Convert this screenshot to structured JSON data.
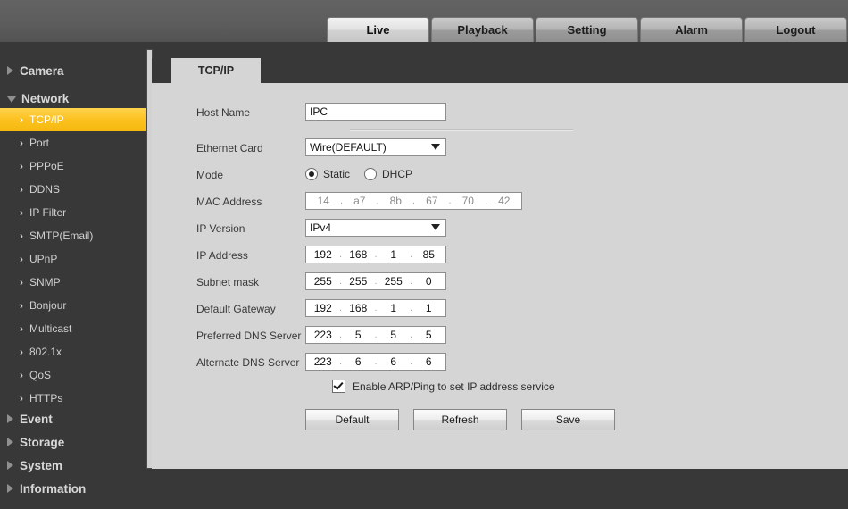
{
  "header": {
    "tabs": [
      {
        "label": "Live",
        "active": true
      },
      {
        "label": "Playback",
        "active": false
      },
      {
        "label": "Setting",
        "active": false
      },
      {
        "label": "Alarm",
        "active": false
      },
      {
        "label": "Logout",
        "active": false
      }
    ]
  },
  "sidebar": {
    "groups": [
      {
        "label": "Camera",
        "expanded": false
      },
      {
        "label": "Network",
        "expanded": true
      },
      {
        "label": "Event",
        "expanded": false
      },
      {
        "label": "Storage",
        "expanded": false
      },
      {
        "label": "System",
        "expanded": false
      },
      {
        "label": "Information",
        "expanded": false
      }
    ],
    "network_items": [
      {
        "label": "TCP/IP",
        "selected": true
      },
      {
        "label": "Port",
        "selected": false
      },
      {
        "label": "PPPoE",
        "selected": false
      },
      {
        "label": "DDNS",
        "selected": false
      },
      {
        "label": "IP Filter",
        "selected": false
      },
      {
        "label": "SMTP(Email)",
        "selected": false
      },
      {
        "label": "UPnP",
        "selected": false
      },
      {
        "label": "SNMP",
        "selected": false
      },
      {
        "label": "Bonjour",
        "selected": false
      },
      {
        "label": "Multicast",
        "selected": false
      },
      {
        "label": "802.1x",
        "selected": false
      },
      {
        "label": "QoS",
        "selected": false
      },
      {
        "label": "HTTPs",
        "selected": false
      }
    ]
  },
  "panel": {
    "tab_label": "TCP/IP"
  },
  "form": {
    "host_name": {
      "label": "Host Name",
      "value": "IPC"
    },
    "ethernet_card": {
      "label": "Ethernet Card",
      "value": "Wire(DEFAULT)"
    },
    "mode": {
      "label": "Mode",
      "selected": "Static",
      "options": [
        {
          "label": "Static",
          "checked": true
        },
        {
          "label": "DHCP",
          "checked": false
        }
      ]
    },
    "mac_address": {
      "label": "MAC Address",
      "readonly": true,
      "octets": [
        "14",
        "a7",
        "8b",
        "67",
        "70",
        "42"
      ]
    },
    "ip_version": {
      "label": "IP Version",
      "value": "IPv4"
    },
    "ip_address": {
      "label": "IP Address",
      "octets": [
        "192",
        "168",
        "1",
        "85"
      ]
    },
    "subnet_mask": {
      "label": "Subnet mask",
      "octets": [
        "255",
        "255",
        "255",
        "0"
      ]
    },
    "default_gateway": {
      "label": "Default Gateway",
      "octets": [
        "192",
        "168",
        "1",
        "1"
      ]
    },
    "preferred_dns": {
      "label": "Preferred DNS Server",
      "octets": [
        "223",
        "5",
        "5",
        "5"
      ]
    },
    "alternate_dns": {
      "label": "Alternate DNS Server",
      "octets": [
        "223",
        "6",
        "6",
        "6"
      ]
    },
    "arp_ping": {
      "label": "Enable ARP/Ping to set IP address service",
      "checked": true
    }
  },
  "buttons": [
    {
      "label": "Default"
    },
    {
      "label": "Refresh"
    },
    {
      "label": "Save"
    }
  ],
  "colors": {
    "accent": "#fcc11f",
    "panel_bg": "#d5d5d5",
    "dark_bg": "#383838",
    "header_bg": "#5c5c5c"
  }
}
